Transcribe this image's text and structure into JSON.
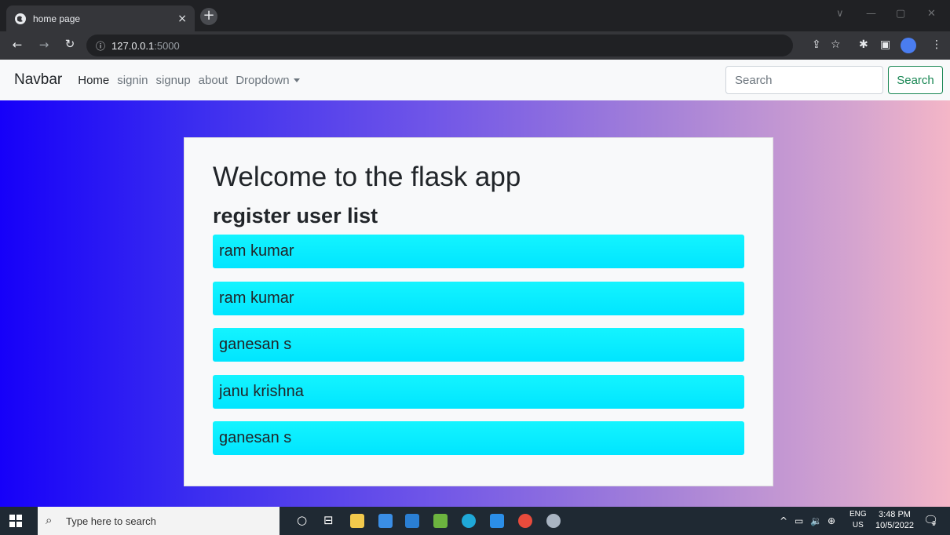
{
  "browser": {
    "tab_title": "home page",
    "tab_close": "×",
    "new_tab": "+",
    "url_host": "127.0.0.1",
    "url_port": ":5000",
    "window_controls": [
      "∨",
      "—",
      "▢",
      "✕"
    ]
  },
  "navbar": {
    "brand": "Navbar",
    "links": [
      "Home",
      "signin",
      "signup",
      "about",
      "Dropdown"
    ],
    "search_placeholder": "Search",
    "search_button": "Search"
  },
  "main": {
    "heading": "Welcome to the flask app",
    "subheading": "register user list",
    "users": [
      "ram kumar",
      "ram kumar",
      "ganesan s",
      "janu krishna",
      "ganesan s"
    ]
  },
  "taskbar": {
    "search_placeholder": "Type here to search",
    "lang_top": "ENG",
    "lang_bottom": "US",
    "time": "3:48 PM",
    "date": "10/5/2022",
    "notification_count": "9"
  },
  "colors": {
    "accent_green": "#198754",
    "user_item": "#00e5ff"
  }
}
